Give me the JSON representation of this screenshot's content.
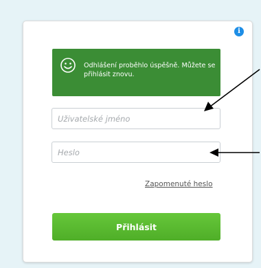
{
  "info": {
    "icon": "info-icon",
    "glyph": "i"
  },
  "message": {
    "icon": "smiley-icon",
    "text": "Odhlášení proběhlo úspěšně. Můžete se přihlásit znovu."
  },
  "form": {
    "username_placeholder": "Uživatelské jméno",
    "password_placeholder": "Heslo",
    "forgot_label": "Zapomenuté heslo",
    "login_label": "Přihlásit"
  },
  "colors": {
    "background": "#e6f3f7",
    "success": "#3b8d35",
    "button": "#5abb31",
    "info": "#1e8ee6"
  }
}
